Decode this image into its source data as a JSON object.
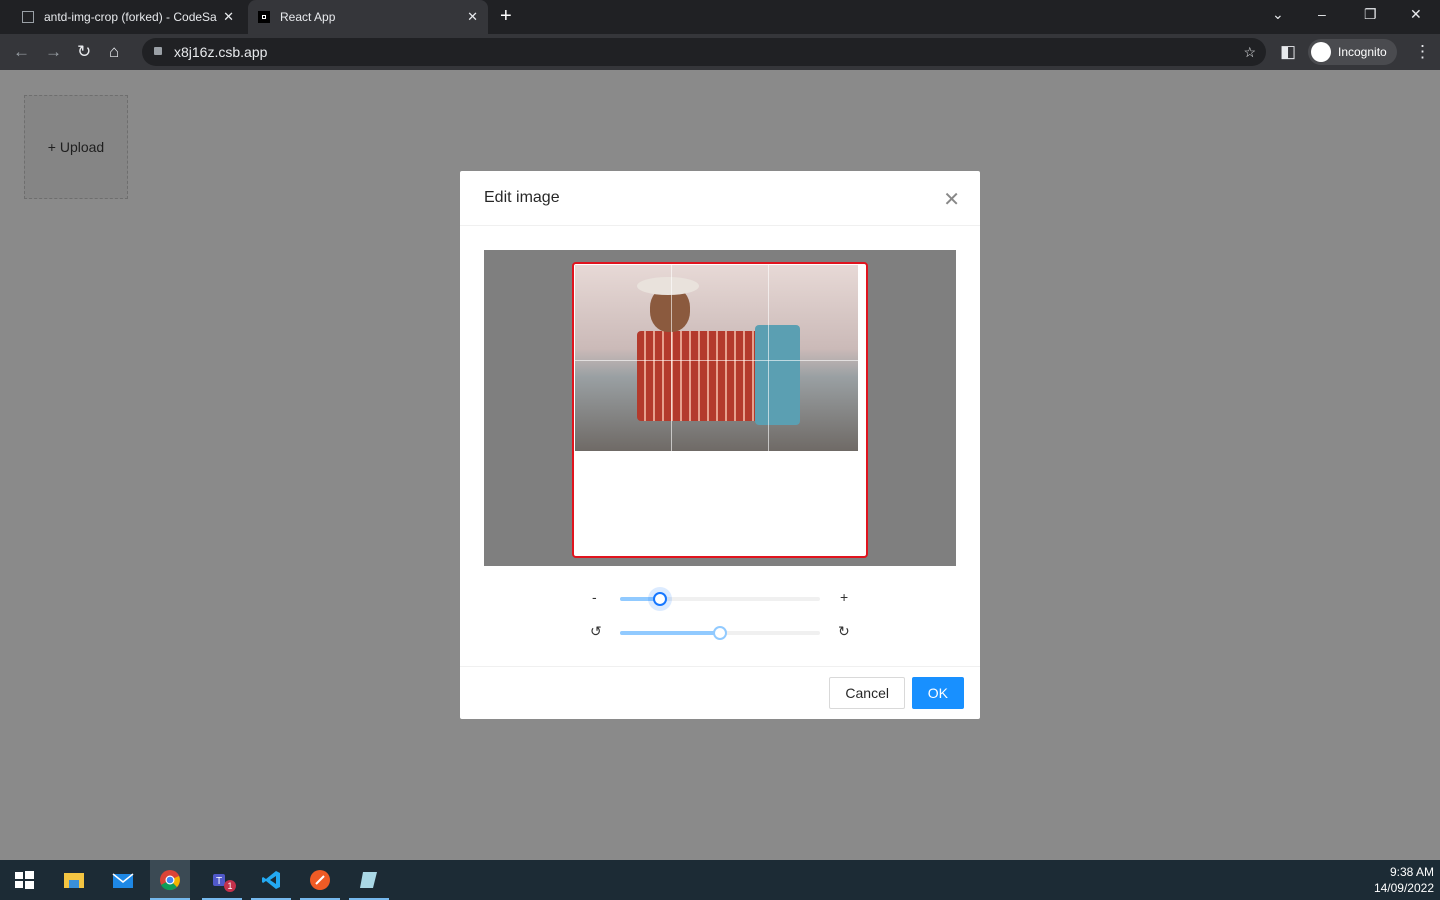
{
  "browser": {
    "tabs": [
      {
        "title": "antd-img-crop (forked) - CodeSa"
      },
      {
        "title": "React App"
      }
    ],
    "url": "x8j16z.csb.app",
    "profile": "Incognito"
  },
  "page": {
    "upload_label": "+ Upload"
  },
  "modal": {
    "title": "Edit image",
    "zoom_minus": "-",
    "zoom_plus": "+",
    "zoom_value_percent": 20,
    "rotate_value_percent": 50,
    "rotate_left": "↺",
    "rotate_right": "↻",
    "cancel_label": "Cancel",
    "ok_label": "OK"
  },
  "taskbar": {
    "apps": [
      "start",
      "file-explorer",
      "mail",
      "chrome",
      "teams",
      "vscode",
      "postman",
      "notepad"
    ],
    "teams_badge": "1",
    "time": "9:38 AM",
    "date": "14/09/2022"
  }
}
